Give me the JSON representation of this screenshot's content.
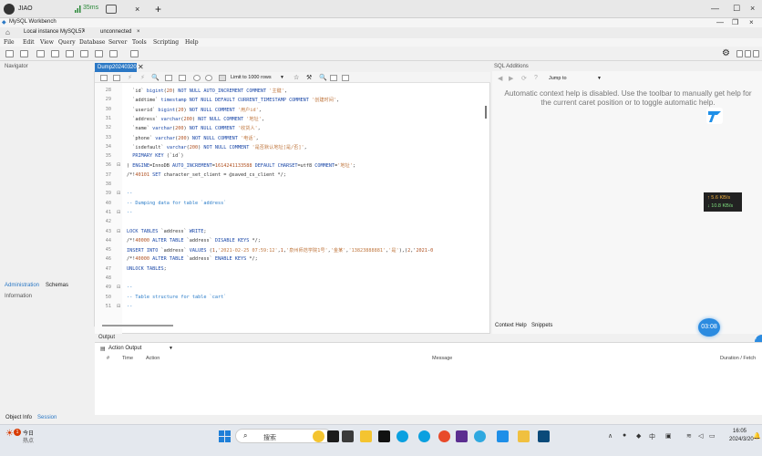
{
  "window": {
    "user": "JIAO",
    "ping": "35ms",
    "app_title": "MySQL Workbench",
    "tabs": [
      "Local instance MySQL57",
      "unconnected"
    ],
    "tab_close": "×"
  },
  "menu": [
    "File",
    "Edit",
    "View",
    "Query",
    "Database",
    "Server",
    "Tools",
    "Scripting",
    "Help"
  ],
  "panels": {
    "navigator": "Navigator",
    "sql_additions": "SQL Additions",
    "nav_tabs": [
      "Administration",
      "Schemas"
    ],
    "information": "Information",
    "object_info_tabs": [
      "Object Info",
      "Session"
    ],
    "right_tabs": [
      "Context Help",
      "Snippets"
    ]
  },
  "editor": {
    "tab_label": "Dump20240320",
    "limit": "Limit to 1000 rows",
    "jump_to": "Jump to",
    "help_text": "Automatic context help is disabled. Use the toolbar to manually get help for the current caret position or to toggle automatic help.",
    "lines": [
      {
        "n": "28",
        "t": "  `id` bigint(20) NOT NULL AUTO_INCREMENT COMMENT '主键',"
      },
      {
        "n": "29",
        "t": "  `addtime` timestamp NOT NULL DEFAULT CURRENT_TIMESTAMP COMMENT '创建时间',"
      },
      {
        "n": "30",
        "t": "  `userid` bigint(20) NOT NULL COMMENT '用户id',"
      },
      {
        "n": "31",
        "t": "  `address` varchar(200) NOT NULL COMMENT '地址',"
      },
      {
        "n": "32",
        "t": "  `name` varchar(200) NOT NULL COMMENT '收货人',"
      },
      {
        "n": "33",
        "t": "  `phone` varchar(200) NOT NULL COMMENT '电话',"
      },
      {
        "n": "34",
        "t": "  `isdefault` varchar(200) NOT NULL COMMENT '是否默认地址[是/否]',"
      },
      {
        "n": "35",
        "t": "  PRIMARY KEY (`id`)"
      },
      {
        "n": "36",
        "t": ") ENGINE=InnoDB AUTO_INCREMENT=1614241133588 DEFAULT CHARSET=utf8 COMMENT='地址';"
      },
      {
        "n": "37",
        "t": "/*!40101 SET character_set_client = @saved_cs_client */;"
      },
      {
        "n": "38",
        "t": ""
      },
      {
        "n": "39",
        "t": "--"
      },
      {
        "n": "40",
        "t": "-- Dumping data for table `address`"
      },
      {
        "n": "41",
        "t": "--"
      },
      {
        "n": "42",
        "t": ""
      },
      {
        "n": "43",
        "t": "LOCK TABLES `address` WRITE;"
      },
      {
        "n": "44",
        "t": "/*!40000 ALTER TABLE `address` DISABLE KEYS */;"
      },
      {
        "n": "45",
        "t": "INSERT INTO `address` VALUES (1,'2021-02-25 07:59:12',1,'泉州师范学院1号','金某','13823888881','是'),(2,'2021-0"
      },
      {
        "n": "46",
        "t": "/*!40000 ALTER TABLE `address` ENABLE KEYS */;"
      },
      {
        "n": "47",
        "t": "UNLOCK TABLES;"
      },
      {
        "n": "48",
        "t": ""
      },
      {
        "n": "49",
        "t": "--"
      },
      {
        "n": "50",
        "t": "-- Table structure for table `cart`"
      },
      {
        "n": "51",
        "t": "--"
      }
    ]
  },
  "output": {
    "title": "Output",
    "action_output": "Action Output",
    "columns": [
      "#",
      "Time",
      "Action",
      "Message",
      "Duration / Fetch"
    ]
  },
  "overlay": {
    "up_speed": "↑ 5.6 KB/s",
    "down_speed": "↓ 10.8 KB/s",
    "timer": "03:08"
  },
  "taskbar": {
    "weather_badge": "1",
    "weather_t1": "今日",
    "weather_t2": "热点",
    "search": "搜索",
    "time": "16:05",
    "date": "2024/3/20",
    "lang": "中"
  },
  "colors": {
    "accent": "#2b78c5",
    "keyword": "#1c49a8",
    "comment": "#2a7cc8",
    "string": "#c07840"
  }
}
